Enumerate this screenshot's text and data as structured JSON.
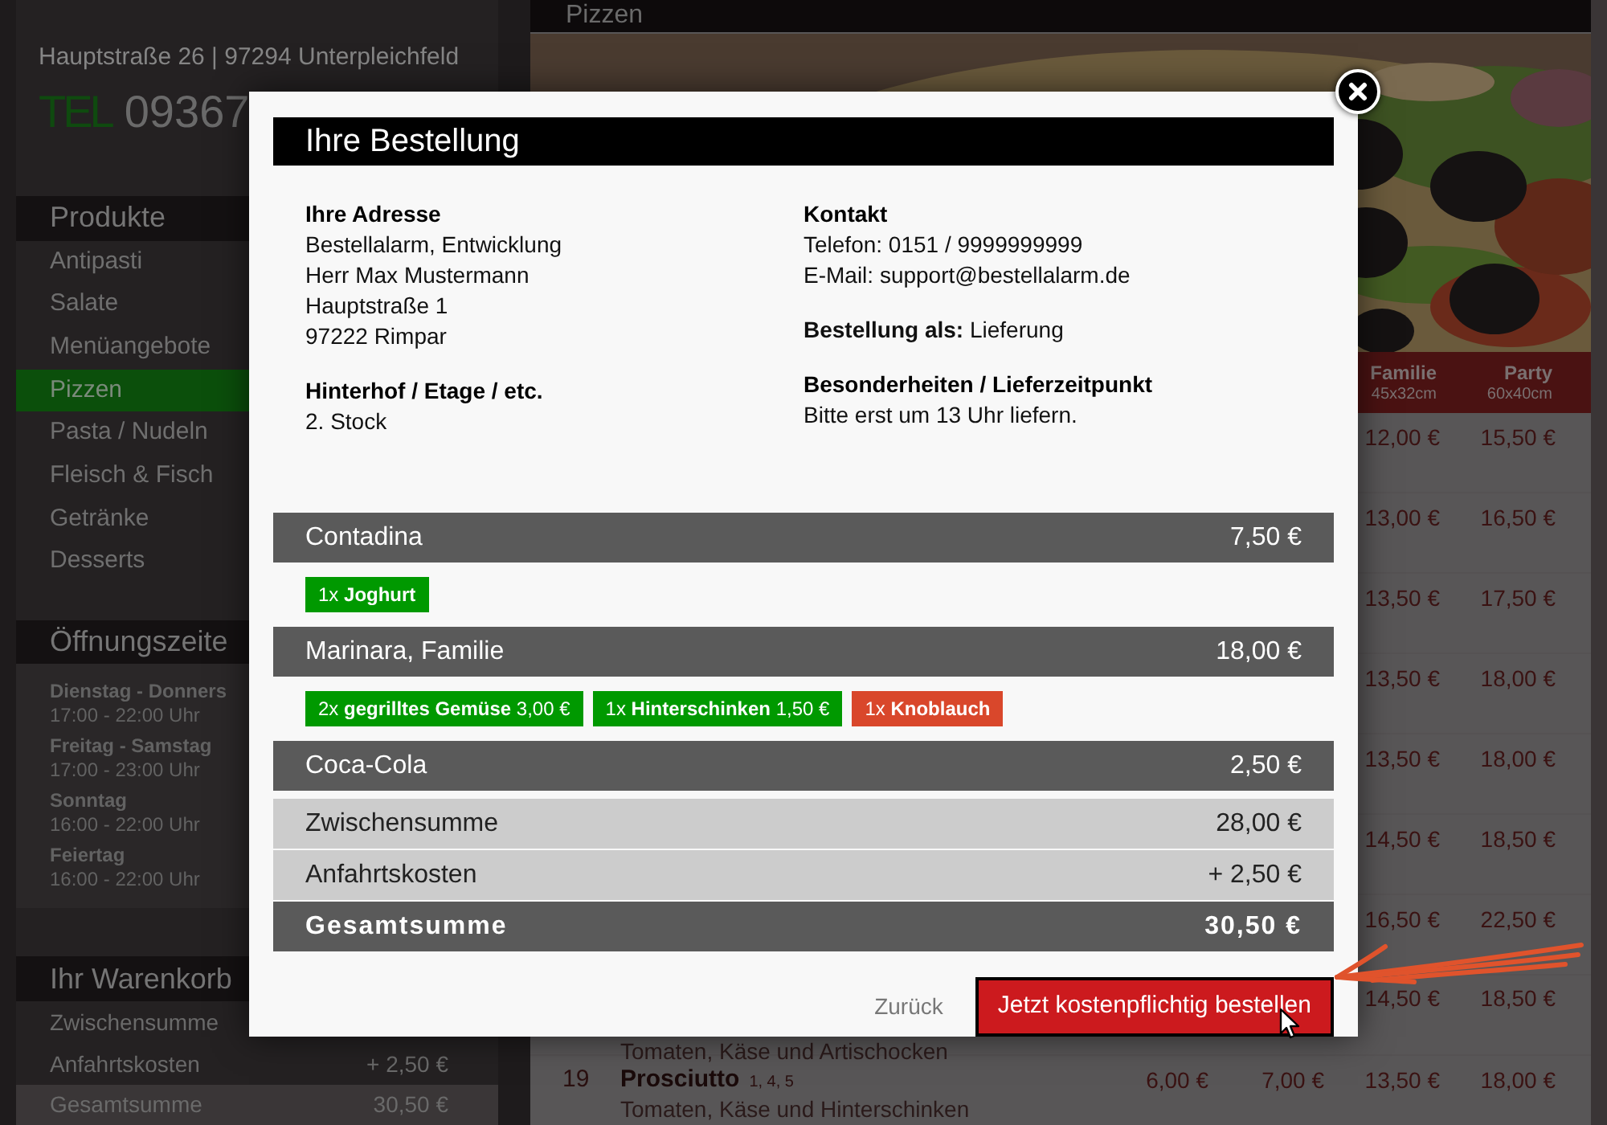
{
  "shop": {
    "address": "Hauptstraße 26 | 97294 Unterpleichfeld",
    "phone_label": "TEL",
    "phone": "09367"
  },
  "products": {
    "title": "Produkte",
    "items": [
      {
        "label": "Antipasti",
        "selected": false
      },
      {
        "label": "Salate",
        "selected": false
      },
      {
        "label": "Menüangebote",
        "selected": false
      },
      {
        "label": "Pizzen",
        "selected": true
      },
      {
        "label": "Pasta / Nudeln",
        "selected": false
      },
      {
        "label": "Fleisch & Fisch",
        "selected": false
      },
      {
        "label": "Getränke",
        "selected": false
      },
      {
        "label": "Desserts",
        "selected": false
      }
    ]
  },
  "opening_hours": {
    "title": "Öffnungszeite",
    "items": [
      {
        "days": "Dienstag - Donners",
        "time": "17:00 - 22:00 Uhr"
      },
      {
        "days": "Freitag - Samstag",
        "time": "17:00 - 23:00 Uhr"
      },
      {
        "days": "Sonntag",
        "time": "16:00 - 22:00 Uhr"
      },
      {
        "days": "Feiertag",
        "time": "16:00 - 22:00 Uhr"
      }
    ]
  },
  "cart": {
    "title": "Ihr Warenkorb",
    "rows": [
      {
        "label": "Zwischensumme",
        "highlighted": false
      },
      {
        "label": "Anfahrtskosten",
        "value": "+ 2,50 €",
        "highlighted": false
      },
      {
        "label": "Gesamtsumme",
        "value": "30,50 €",
        "highlighted": true
      }
    ]
  },
  "main": {
    "title": "Pizzen",
    "table": {
      "columns": [
        {
          "name": "Familie",
          "size": "45x32cm"
        },
        {
          "name": "Party",
          "size": "60x40cm"
        }
      ],
      "rows": [
        {
          "familie": "12,00 €",
          "party": "15,50 €"
        },
        {
          "familie": "13,00 €",
          "party": "16,50 €"
        },
        {
          "familie": "13,50 €",
          "party": "17,50 €"
        },
        {
          "familie": "13,50 €",
          "party": "18,00 €"
        },
        {
          "familie": "13,50 €",
          "party": "18,00 €"
        },
        {
          "familie": "14,50 €",
          "party": "18,50 €"
        },
        {
          "familie": "16,50 €",
          "party": "22,50 €"
        },
        {
          "familie": "14,50 €",
          "party": "18,50 €",
          "description": "Tomaten, Käse und Artischocken"
        },
        {
          "number": "19",
          "name": "Prosciutto",
          "allergens": "1, 4, 5",
          "klein": "6,00 €",
          "normal": "7,00 €",
          "familie": "13,50 €",
          "party": "18,00 €",
          "description": "Tomaten, Käse und Hinterschinken"
        }
      ]
    }
  },
  "modal": {
    "title": "Ihre Bestellung",
    "columns": [
      [
        {
          "title": "Ihre Adresse",
          "lines": [
            "Bestellalarm, Entwicklung",
            "Herr Max Mustermann",
            "Hauptstraße 1",
            "97222 Rimpar"
          ]
        },
        {
          "title": "Hinterhof / Etage / etc.",
          "lines": [
            "2. Stock"
          ]
        }
      ],
      [
        {
          "title": "Kontakt",
          "lines": [
            "Telefon: 0151 / 9999999999",
            "E-Mail: support@bestellalarm.de"
          ]
        },
        {
          "lines": [
            "**Bestellung als:** Lieferung"
          ]
        },
        {
          "title": "Besonderheiten / Lieferzeitpunkt",
          "lines": [
            "Bitte erst um 13 Uhr liefern."
          ]
        }
      ]
    ],
    "items": [
      {
        "name": "Contadina",
        "price": "7,50 €",
        "extras": [
          {
            "text": "1x **Joghurt**",
            "color": "#009900"
          }
        ]
      },
      {
        "name": "Marinara, Familie",
        "price": "18,00 €",
        "extras": [
          {
            "text": "2x **gegrilltes Gemüse** 3,00 €",
            "color": "#009900"
          },
          {
            "text": "1x **Hinterschinken** 1,50 €",
            "color": "#009900"
          },
          {
            "text": "1x **Knoblauch**",
            "color": "#d9472b"
          }
        ]
      },
      {
        "name": "Coca-Cola",
        "price": "2,50 €"
      }
    ],
    "totals": [
      {
        "kind": "subtotal",
        "label": "Zwischensumme",
        "value": "28,00 €"
      },
      {
        "kind": "subtotal",
        "label": "Anfahrtskosten",
        "value": "+ 2,50 €"
      },
      {
        "kind": "total",
        "label": "Gesamtsumme",
        "value": "30,50 €"
      }
    ],
    "back_link": "Zurück",
    "order_button": "Jetzt kostenpflichtig bestellen"
  }
}
